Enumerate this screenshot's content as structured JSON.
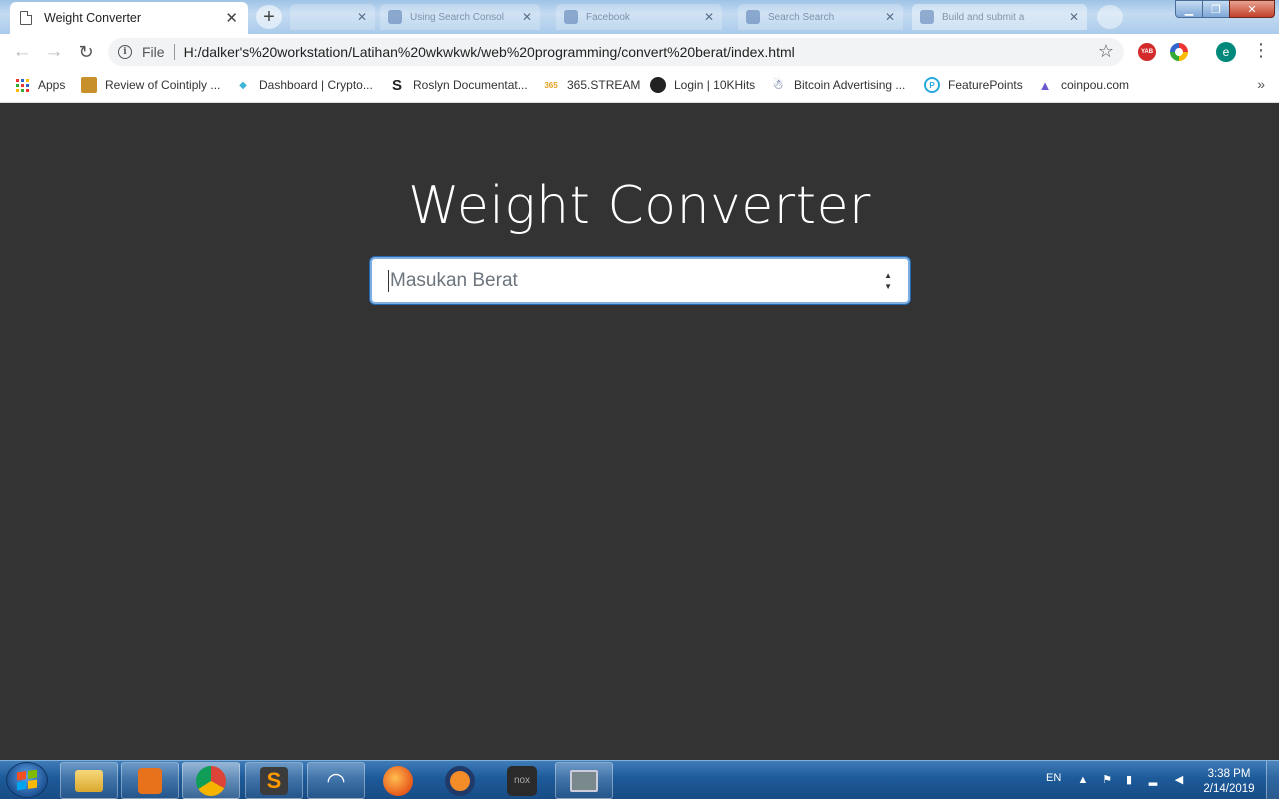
{
  "browser": {
    "active_tab_title": "Weight Converter",
    "background_tabs": [
      "",
      "Using Search Consol",
      "Facebook",
      "Search Search",
      "Build and submit a"
    ],
    "url_scheme": "File",
    "url": "H:/dalker's%20workstation/Latihan%20wkwkwk/web%20programming/convert%20berat/index.html",
    "profile_initial": "e",
    "extension_1": "YAB"
  },
  "bookmarks": [
    {
      "label": "Apps"
    },
    {
      "label": "Review of Cointiply ..."
    },
    {
      "label": "Dashboard | Crypto..."
    },
    {
      "label": "Roslyn Documentat..."
    },
    {
      "label": "365.STREAM"
    },
    {
      "label": "Login | 10KHits"
    },
    {
      "label": "Bitcoin Advertising ..."
    },
    {
      "label": "FeaturePoints"
    },
    {
      "label": "coinpou.com"
    }
  ],
  "page": {
    "heading": "Weight Converter",
    "input_placeholder": "Masukan Berat"
  },
  "taskbar": {
    "language": "EN",
    "time": "3:38 PM",
    "date": "2/14/2019"
  },
  "colors": {
    "page_background": "#333333",
    "input_focus_border": "#80aee0",
    "taskbar": "#1d5a99"
  }
}
